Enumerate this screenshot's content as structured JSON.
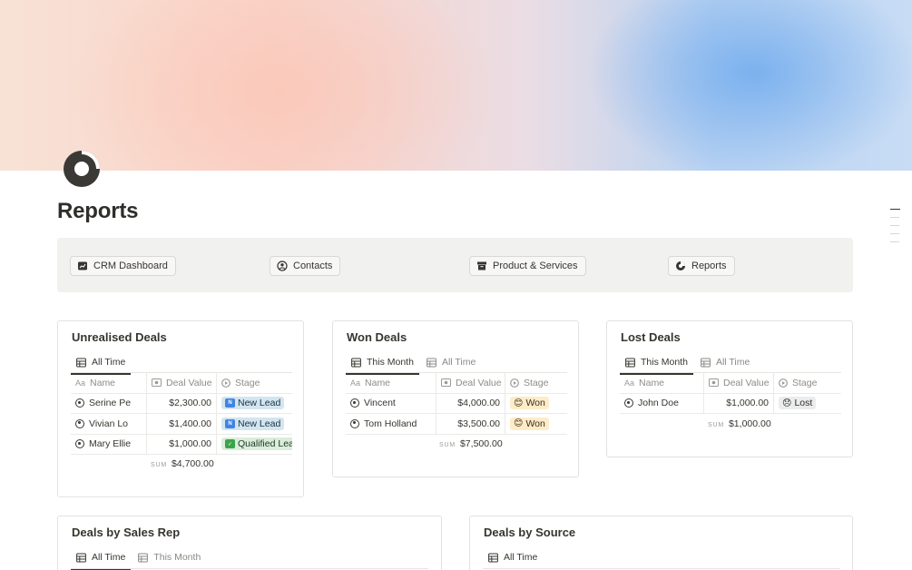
{
  "page": {
    "title": "Reports",
    "icon": "pie-chart-icon"
  },
  "nav": [
    {
      "label": "CRM Dashboard",
      "icon": "dashboard-icon"
    },
    {
      "label": "Contacts",
      "icon": "person-circle-icon"
    },
    {
      "label": "Product & Services",
      "icon": "archive-box-icon"
    },
    {
      "label": "Reports",
      "icon": "pie-chart-icon"
    }
  ],
  "unrealised": {
    "title": "Unrealised Deals",
    "tabs": [
      "All Time"
    ],
    "headers": [
      "Name",
      "Deal Value",
      "Stage"
    ],
    "rows": [
      {
        "name": "Serine Pe",
        "value": "$2,300.00",
        "stage": "New Lead"
      },
      {
        "name": "Vivian Lo",
        "value": "$1,400.00",
        "stage": "New Lead"
      },
      {
        "name": "Mary Ellie",
        "value": "$1,000.00",
        "stage": "Qualified Lead"
      }
    ],
    "sum_label": "SUM",
    "sum": "$4,700.00"
  },
  "won": {
    "title": "Won Deals",
    "tabs": [
      "This Month",
      "All Time"
    ],
    "headers": [
      "Name",
      "Deal Value",
      "Stage"
    ],
    "rows": [
      {
        "name": "Vincent",
        "value": "$4,000.00",
        "stage": "Won"
      },
      {
        "name": "Tom Holland",
        "value": "$3,500.00",
        "stage": "Won"
      }
    ],
    "sum_label": "SUM",
    "sum": "$7,500.00"
  },
  "lost": {
    "title": "Lost Deals",
    "tabs": [
      "This Month",
      "All Time"
    ],
    "headers": [
      "Name",
      "Deal Value",
      "Stage"
    ],
    "rows": [
      {
        "name": "John Doe",
        "value": "$1,000.00",
        "stage": "Lost"
      }
    ],
    "sum_label": "SUM",
    "sum": "$1,000.00"
  },
  "by_sales_rep": {
    "title": "Deals by Sales Rep",
    "tabs": [
      "All Time",
      "This Month"
    ]
  },
  "by_source": {
    "title": "Deals by Source",
    "tabs": [
      "All Time"
    ]
  },
  "header_icons": {
    "name": "Aa",
    "value": "banknote-icon",
    "stage": "status-icon"
  },
  "colors": {
    "text": "#37352f",
    "tag_blue": "#d3e5ef",
    "tag_green": "#dbeddb",
    "tag_yellow": "#fdecc8",
    "tag_gray": "#ebeced"
  }
}
